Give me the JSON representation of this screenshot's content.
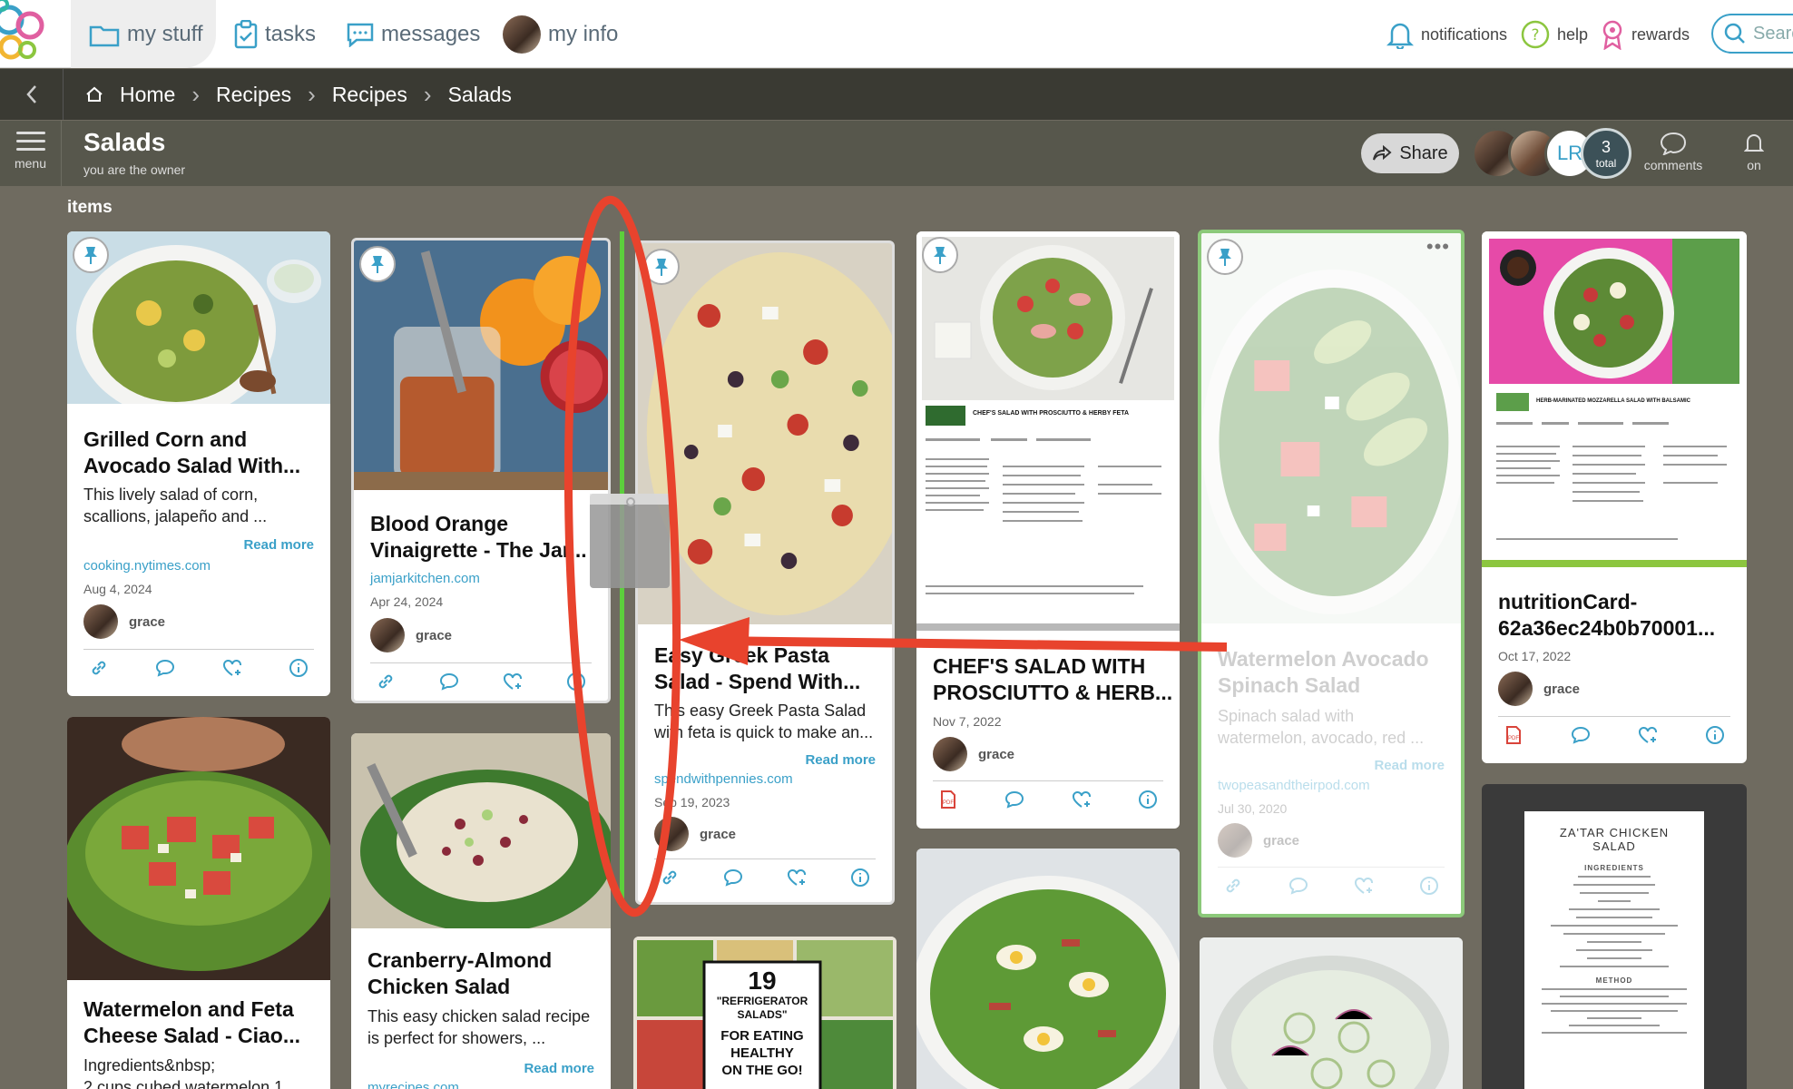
{
  "topnav": {
    "tabs": [
      {
        "label": "my stuff"
      },
      {
        "label": "tasks"
      },
      {
        "label": "messages"
      },
      {
        "label": "my info"
      }
    ],
    "notifications_label": "notifications",
    "help_label": "help",
    "rewards_label": "rewards",
    "search_placeholder": "Searc"
  },
  "breadcrumb": [
    "Home",
    "Recipes",
    "Recipes",
    "Salads"
  ],
  "header": {
    "title": "Salads",
    "subtitle": "you are the owner",
    "menu_label": "menu",
    "share_label": "Share",
    "avatar_initials": "LR",
    "member_count": "3",
    "member_count_label": "total",
    "comments_label": "comments",
    "notify_label": "on"
  },
  "section_label": "items",
  "cards": [
    {
      "title_l1": "Grilled Corn and",
      "title_l2": "Avocado Salad With...",
      "desc_l1": "This lively salad of corn,",
      "desc_l2": "scallions, jalapeño and ...",
      "read_more": "Read more",
      "source": "cooking.nytimes.com",
      "date": "Aug 4, 2024",
      "owner": "grace"
    },
    {
      "title_l1": "Blood Orange",
      "title_l2": "Vinaigrette - The Jar...",
      "source": "jamjarkitchen.com",
      "date": "Apr 24, 2024",
      "owner": "grace"
    },
    {
      "title_l1": "Easy Greek Pasta",
      "title_l2": "Salad - Spend With...",
      "desc_l1": "This easy Greek Pasta Salad",
      "desc_l2": "with feta is quick to make an...",
      "read_more": "Read more",
      "source": "spendwithpennies.com",
      "date": "Sep 19, 2023",
      "owner": "grace"
    },
    {
      "title_l1": "CHEF'S SALAD WITH",
      "title_l2": "PROSCIUTTO & HERB...",
      "date": "Nov 7, 2022",
      "owner": "grace",
      "doc_heading": "CHEF'S SALAD WITH PROSCIUTTO & HERBY FETA"
    },
    {
      "title_l1": "Watermelon Avocado",
      "title_l2": "Spinach Salad",
      "desc_l1": "Spinach salad with",
      "desc_l2": "watermelon, avocado, red ...",
      "read_more": "Read more",
      "source": "twopeasandtheirpod.com",
      "date": "Jul 30, 2020",
      "owner": "grace"
    },
    {
      "title_l1": "nutritionCard-",
      "title_l2": "62a36ec24b0b70001...",
      "date": "Oct 17, 2022",
      "owner": "grace",
      "doc_heading": "HERB-MARINATED MOZZARELLA SALAD WITH BALSAMIC"
    },
    {
      "title_l1": "Watermelon and Feta",
      "title_l2": "Cheese Salad - Ciao...",
      "desc_l1": "Ingredients&nbsp;",
      "desc_l2": "2 cups cubed watermelon 1"
    },
    {
      "title_l1": "Cranberry-Almond",
      "title_l2": "Chicken Salad",
      "desc_l1": "This easy chicken salad recipe",
      "desc_l2": "is perfect for showers, ...",
      "read_more": "Read more",
      "source": "myrecipes.com"
    },
    {
      "poster_num": "19",
      "poster_l1": "\"REFRIGERATOR",
      "poster_l2": "SALADS\"",
      "poster_l3": "FOR EATING",
      "poster_l4": "HEALTHY",
      "poster_l5": "ON THE GO!"
    },
    {
      "doc_title_l1": "ZA'TAR CHICKEN",
      "doc_title_l2": "SALAD",
      "doc_ingredients": "INGREDIENTS",
      "doc_method": "METHOD"
    }
  ],
  "colors": {
    "accent": "#3aa0c8",
    "pdf": "#d9443a",
    "annotation": "#e8432d",
    "drop_line": "#5ccf3c"
  }
}
